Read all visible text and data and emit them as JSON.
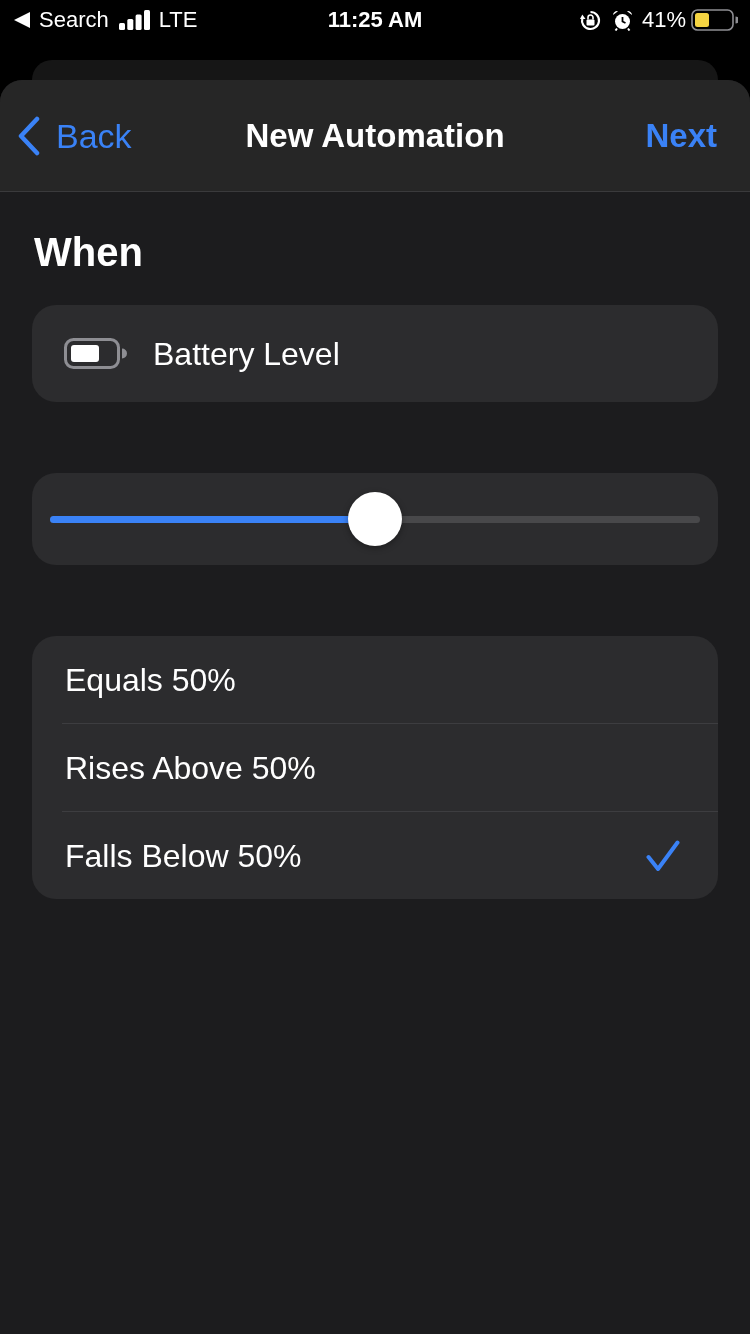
{
  "status_bar": {
    "back_label": "Search",
    "network": "LTE",
    "time": "11:25 AM",
    "battery_percent": "41%"
  },
  "nav_bar": {
    "back": "Back",
    "title": "New Automation",
    "next": "Next"
  },
  "section_title": "When",
  "trigger": {
    "label": "Battery Level"
  },
  "slider": {
    "level": 0.5
  },
  "options": [
    {
      "label": "Equals 50%",
      "selected": false
    },
    {
      "label": "Rises Above 50%",
      "selected": false
    },
    {
      "label": "Falls Below 50%",
      "selected": true
    }
  ]
}
